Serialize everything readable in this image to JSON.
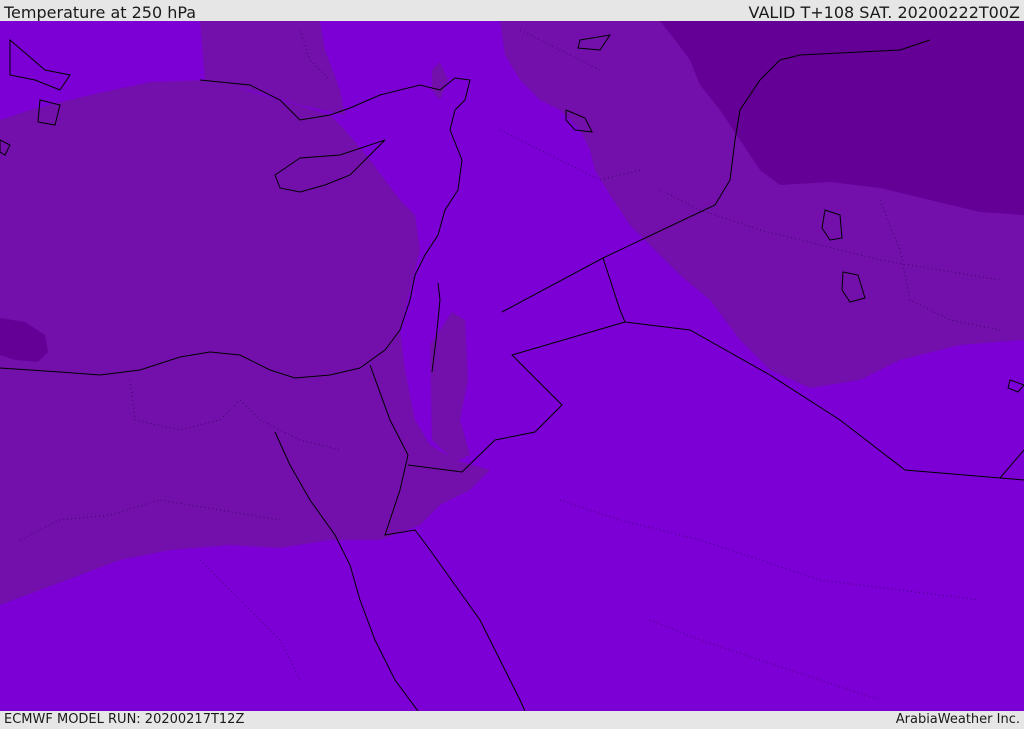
{
  "header": {
    "title": "Temperature at 250 hPa",
    "valid": "VALID T+108 SAT. 20200222T00Z"
  },
  "footer": {
    "model_run": "ECMWF MODEL RUN: 20200217T12Z",
    "credit": "ArabiaWeather Inc."
  },
  "map": {
    "field": "temperature",
    "level": "250 hPa",
    "colors": {
      "band_warm": "#7c00d6",
      "band_mid": "#7310ac",
      "band_cold": "#650096",
      "coastline": "#000000"
    }
  }
}
